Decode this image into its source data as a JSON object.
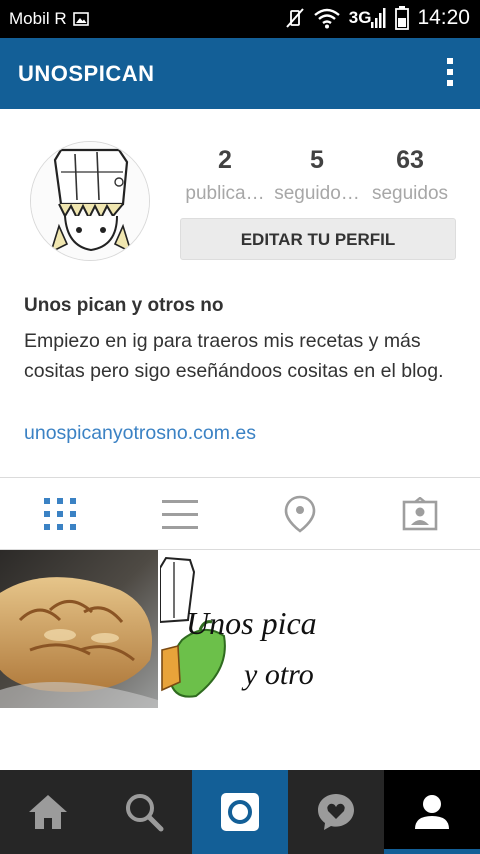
{
  "status_bar": {
    "carrier": "Mobil R",
    "network": "3G",
    "time": "14:20"
  },
  "app_bar": {
    "title": "UNOSPICAN"
  },
  "profile": {
    "stats": [
      {
        "value": "2",
        "label": "publica…"
      },
      {
        "value": "5",
        "label": "seguido…"
      },
      {
        "value": "63",
        "label": "seguidos"
      }
    ],
    "edit_button": "EDITAR TU PERFIL",
    "name": "Unos pican y otros no",
    "bio": "Empiezo en ig para traeros mis recetas y más cositas pero sigo eseñándoos cositas en el blog.",
    "website": "unospicanyotrosno.com.es"
  },
  "tabs": [
    {
      "icon": "grid-icon",
      "active": true
    },
    {
      "icon": "list-icon",
      "active": false
    },
    {
      "icon": "location-pin-icon",
      "active": false
    },
    {
      "icon": "tagged-icon",
      "active": false
    }
  ],
  "posts": [
    {
      "type": "food-photo"
    },
    {
      "type": "logo-image",
      "logo_text_line1": "Unos pica",
      "logo_text_line2": "y otro"
    }
  ],
  "bottom_nav": [
    {
      "icon": "home-icon"
    },
    {
      "icon": "search-icon"
    },
    {
      "icon": "camera-icon"
    },
    {
      "icon": "activity-heart-icon"
    },
    {
      "icon": "profile-icon",
      "active": true
    }
  ],
  "colors": {
    "brand_blue": "#135f97",
    "link_blue": "#3b82c4",
    "tab_active": "#3b82c4",
    "nav_bg": "#262626"
  }
}
